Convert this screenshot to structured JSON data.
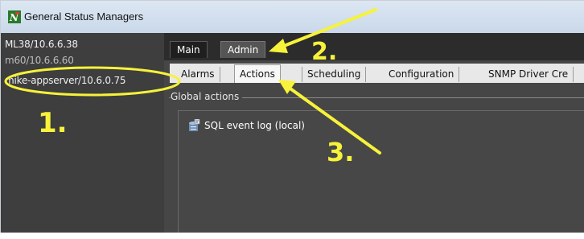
{
  "window": {
    "title": "General Status Managers",
    "icon": "gsm-app-icon"
  },
  "sidebar": {
    "items": [
      {
        "label": "ML38/10.6.6.38"
      },
      {
        "label": "m60/10.6.6.60"
      },
      {
        "label": "mike-appserver/10.6.0.75"
      }
    ]
  },
  "top_tabs": [
    {
      "label": "Main"
    },
    {
      "label": "Admin"
    }
  ],
  "sub_tabs": [
    {
      "label": "Alarms"
    },
    {
      "label": "Actions"
    },
    {
      "label": "Scheduling"
    },
    {
      "label": "Configuration"
    },
    {
      "label": "SNMP Driver Cre"
    }
  ],
  "group": {
    "label": "Global actions"
  },
  "actions": [
    {
      "label": "SQL event log (local)",
      "icon": "database-action-icon"
    }
  ],
  "annotations": {
    "step1": "1.",
    "step2": "2.",
    "step3": "3.",
    "color": "#f7f23a"
  }
}
